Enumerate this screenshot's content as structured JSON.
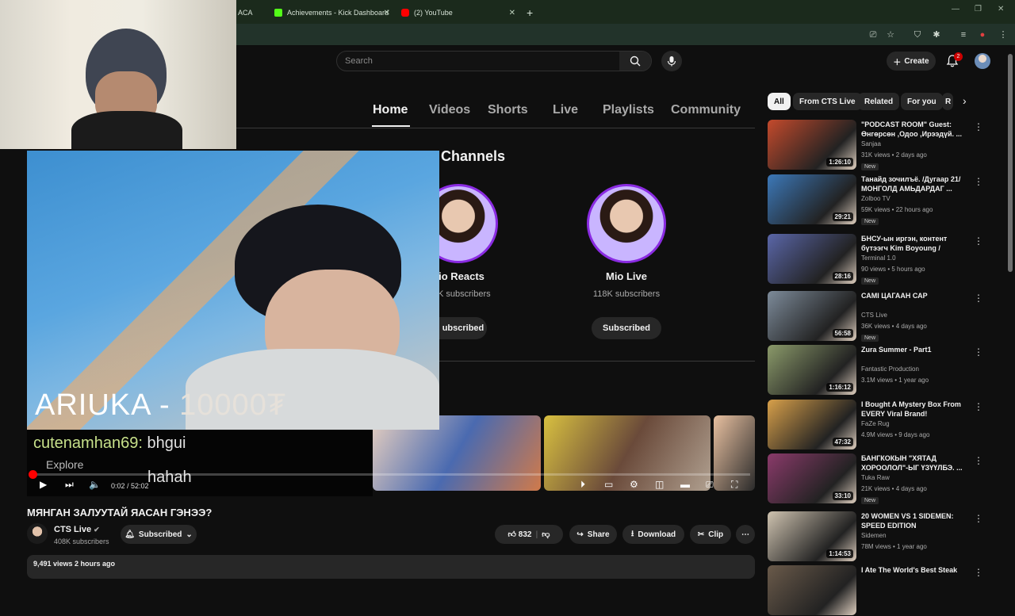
{
  "browser": {
    "tabs": [
      {
        "label": "ACA"
      },
      {
        "label": "Achievements - Kick Dashboard"
      },
      {
        "label": "(2) YouTube"
      }
    ]
  },
  "youtube": {
    "search_placeholder": "Search",
    "create_label": "Create",
    "notifications": "2",
    "channel_tabs": [
      "Home",
      "Videos",
      "Shorts",
      "Live",
      "Playlists",
      "Community"
    ],
    "active_tab": "Home"
  },
  "channels_section": {
    "title": "Channels",
    "cards": [
      {
        "name": "io Reacts",
        "subs": "K subscribers",
        "button": "ubscribed"
      },
      {
        "name": "Mio Live",
        "subs": "118K subscribers",
        "button": "Subscribed"
      }
    ]
  },
  "stream_overlay": {
    "donation_name": "ARIUKA - ",
    "donation_amount": "10000₮",
    "chat_user": "cutenamhan69:",
    "chat_message": " bhgui",
    "explore": "Explore",
    "chat2_message": "hahah"
  },
  "player": {
    "time": "0:02 / 52:02",
    "progress": 0.001
  },
  "video": {
    "title": "МЯНГАН ЗАЛУУТАЙ ЯАСАН ГЭНЭЭ?",
    "channel": "CTS Live",
    "subscribers": "408K subscribers",
    "subscribe_label": "Subscribed",
    "likes": "832",
    "share": "Share",
    "download": "Download",
    "clip": "Clip",
    "views_time": "9,491 views  2 hours ago"
  },
  "related": {
    "chips": [
      "All",
      "From CTS Live",
      "Related",
      "For you",
      "R"
    ],
    "items": [
      {
        "title": "\"PODCAST ROOM\" Guest: Өнгөрсөн ,Одоо ,Ирээдүй. ...",
        "channel": "Sanjaa",
        "meta": "31K views • 2 days ago",
        "new": "New",
        "duration": "1:26:10",
        "color": "#c44a2c"
      },
      {
        "title": "Танайд зочилъё. /Дугаар 21/ МОНГОЛД АМЬДАРДАГ ...",
        "channel": "Zolboo TV",
        "meta": "59K views • 22 hours ago",
        "new": "New",
        "duration": "29:21",
        "color": "#3c78b8"
      },
      {
        "title": "БНСУ-ын иргэн, контент бүтээгч Kim Boyoung /Буяна...",
        "channel": "Terminal 1.0",
        "meta": "90 views • 5 hours ago",
        "new": "New",
        "duration": "28:16",
        "color": "#5a66a8"
      },
      {
        "title": "САМІ ЦАГААН САР",
        "channel": "CTS Live",
        "meta": "36K views • 4 days ago",
        "new": "New",
        "duration": "56:58",
        "color": "#7d8b9a"
      },
      {
        "title": "Zura Summer - Part1",
        "channel": "Fantastic Production",
        "meta": "3.1M views • 1 year ago",
        "new": "",
        "duration": "1:16:12",
        "color": "#8b9a6a"
      },
      {
        "title": "I Bought A Mystery Box From EVERY Viral Brand!",
        "channel": "FaZe Rug",
        "meta": "4.9M views • 9 days ago",
        "new": "",
        "duration": "47:32",
        "color": "#d8a04a"
      },
      {
        "title": "БАНГКОКЫН \"ХЯТАД ХОРООЛОЛ\"-ЫГ ҮЗҮҮЛБЭ. ...",
        "channel": "Tuka Raw",
        "meta": "21K views • 4 days ago",
        "new": "New",
        "duration": "33:10",
        "color": "#8a3a6a"
      },
      {
        "title": "20 WOMEN VS 1 SIDEMEN: SPEED EDITION",
        "channel": "Sidemen",
        "meta": "78M views • 1 year ago",
        "new": "",
        "duration": "1:14:53",
        "color": "#cfc3b0"
      },
      {
        "title": "I Ate The World's Best Steak",
        "channel": "",
        "meta": "",
        "new": "",
        "duration": "",
        "color": "#6a5a4a"
      }
    ]
  }
}
